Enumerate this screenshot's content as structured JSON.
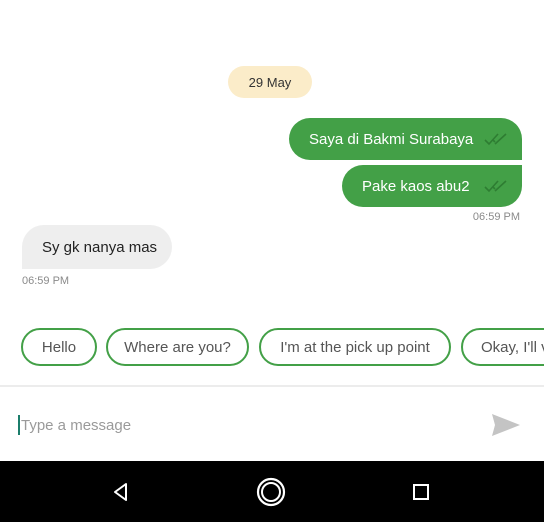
{
  "chat": {
    "date_label": "29 May",
    "outgoing": [
      {
        "text": "Saya di Bakmi Surabaya",
        "status_icon": "double-check-icon"
      },
      {
        "text": "Pake kaos abu2",
        "status_icon": "double-check-icon"
      }
    ],
    "outgoing_time": "06:59 PM",
    "incoming": [
      {
        "text": "Sy gk nanya mas"
      }
    ],
    "incoming_time": "06:59 PM"
  },
  "quick_replies": [
    "Hello",
    "Where are you?",
    "I'm at the pick up point",
    "Okay, I'll v"
  ],
  "composer": {
    "placeholder": "Type a message",
    "send_icon": "send-icon"
  },
  "navbar": {
    "back_icon": "back-triangle-icon",
    "home_icon": "home-circle-icon",
    "recents_icon": "recents-square-icon"
  },
  "colors": {
    "accent": "#43a047",
    "date_chip": "#fbecc9",
    "incoming_bubble": "#eeeeee",
    "navbar": "#000000"
  }
}
